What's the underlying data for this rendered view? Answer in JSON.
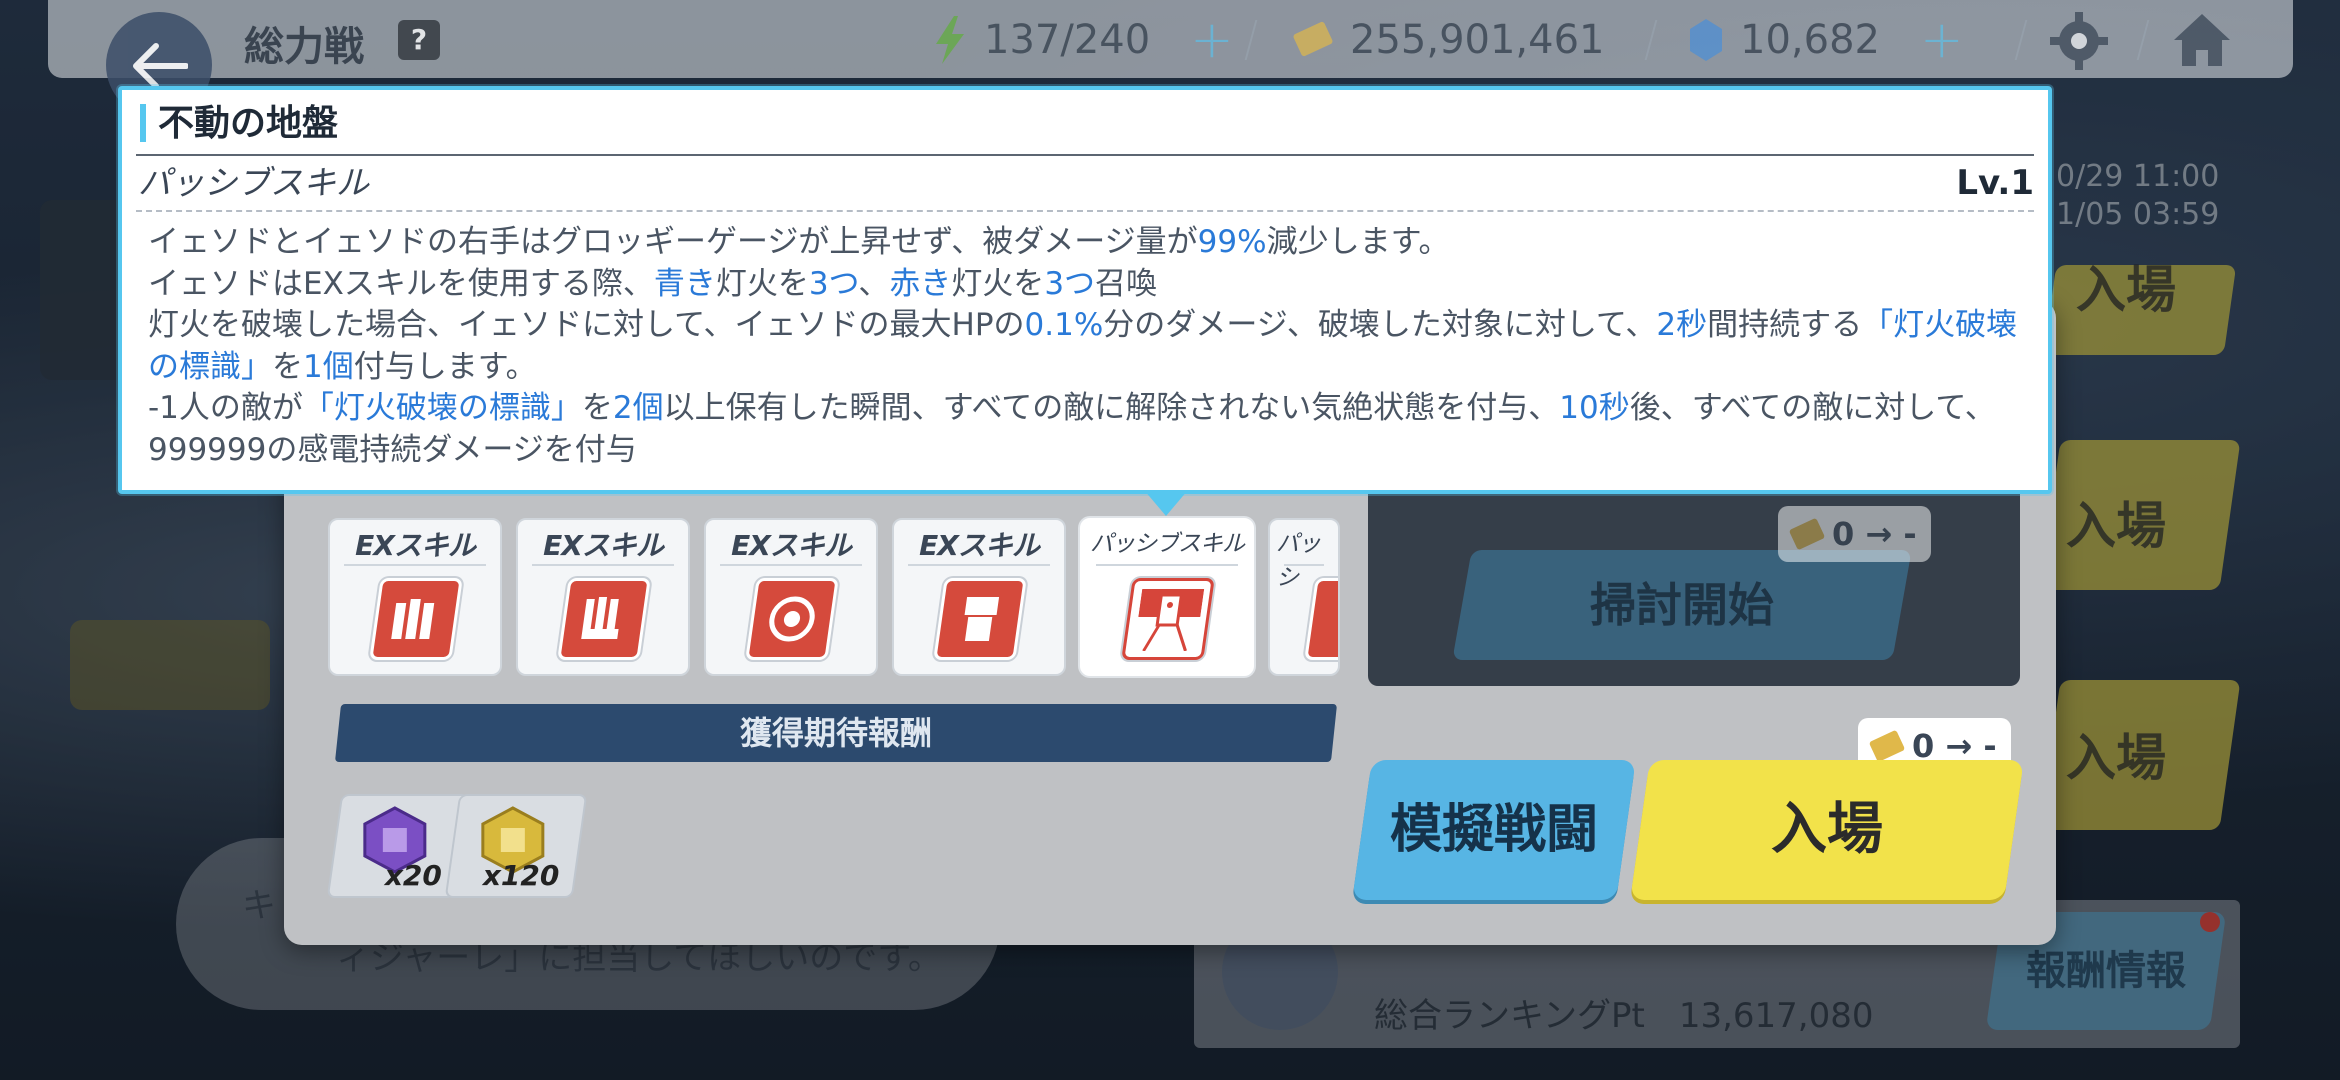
{
  "header": {
    "title": "総力戦",
    "help_icon": "?",
    "stamina": "137/240",
    "credits": "255,901,461",
    "gems": "10,682"
  },
  "schedule": {
    "line1": "0/29 11:00",
    "line2": "1/05 03:59"
  },
  "background_tabs": {
    "tab1": "入場",
    "tab2": "入場",
    "tab3": "入場"
  },
  "tooltip": {
    "title": "不動の地盤",
    "type": "パッシブスキル",
    "level": "Lv.1",
    "desc": {
      "l1a": "イェソドとイェソドの右手はグロッギーゲージが上昇せず、被ダメージ量が",
      "l1b": "99%",
      "l1c": "減少します。",
      "l2a": "イェソドはEXスキルを使用する際、",
      "l2b": "青き",
      "l2c": "灯火を",
      "l2d": "3つ",
      "l2e": "、",
      "l2f": "赤き",
      "l2g": "灯火を",
      "l2h": "3つ",
      "l2i": "召喚",
      "l3a": "灯火を破壊した場合、イェソドに対して、イェソドの最大HPの",
      "l3b": "0.1%",
      "l3c": "分のダメージ、破壊した対象に対して、",
      "l3d": "2秒",
      "l3e": "間持続する",
      "l3f": "「灯火破壊の標識」",
      "l3g": "を",
      "l3h": "1個",
      "l3i": "付与します。",
      "l4a": "-1人の敵が",
      "l4b": "「灯火破壊の標識」",
      "l4c": "を",
      "l4d": "2個",
      "l4e": "以上保有した瞬間、すべての敵に解除されない気絶状態を付与、",
      "l4f": "10秒",
      "l4g": "後、すべての敵に対して、999999の感電持続ダメージを付与"
    }
  },
  "skills": [
    {
      "label": "EXスキル",
      "icon": "ex-skill-1-icon"
    },
    {
      "label": "EXスキル",
      "icon": "ex-skill-2-icon"
    },
    {
      "label": "EXスキル",
      "icon": "ex-skill-3-icon"
    },
    {
      "label": "EXスキル",
      "icon": "ex-skill-4-icon"
    },
    {
      "label": "パッシブスキル",
      "icon": "passive-skill-icon"
    },
    {
      "label": "パッシ",
      "icon": "passive-skill-2-icon"
    }
  ],
  "rewards": {
    "title": "獲得期待報酬",
    "items": [
      {
        "qty": "x20",
        "icon": "purple-material-icon"
      },
      {
        "qty": "x120",
        "icon": "gold-material-icon"
      }
    ]
  },
  "actions": {
    "sweep_label": "掃討開始",
    "sweep_cost": "0 → -",
    "entry_cost": "0 → -",
    "simulate_label": "模擬戦闘",
    "enter_label": "入場"
  },
  "footer": {
    "speech_text": "キ",
    "speech_line2": "ィジャーレ」に担当してほしいのです。",
    "rank_label": "総合ランキングPt　13,617,080",
    "reward_info_label": "報酬情報"
  },
  "colors": {
    "accent_cyan": "#56c7ef",
    "highlight_blue": "#2a7ad8",
    "enter_yellow": "#f2e24a",
    "simulate_blue": "#57b5e4"
  }
}
